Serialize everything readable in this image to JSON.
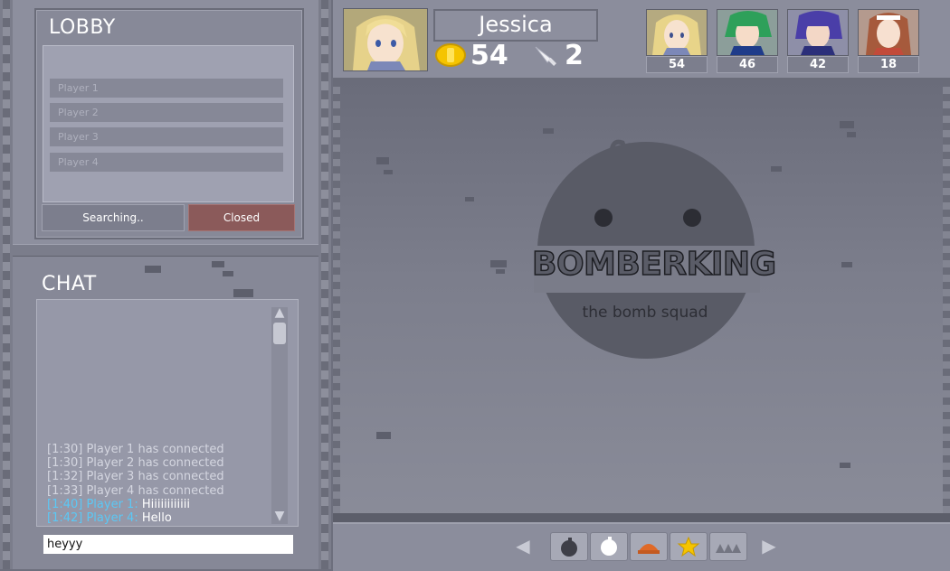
{
  "lobby": {
    "title": "LOBBY",
    "players": [
      "Player 1",
      "Player 2",
      "Player 3",
      "Player 4"
    ],
    "search_label": "Searching..",
    "closed_label": "Closed"
  },
  "chat": {
    "title": "CHAT",
    "messages": [
      {
        "text": "[1:30] Player 1 has connected"
      },
      {
        "text": "[1:30] Player 2 has connected"
      },
      {
        "text": "[1:32] Player 3 has connected"
      },
      {
        "text": "[1:33] Player 4 has connected"
      },
      {
        "who": "[1:40] Player 1:",
        "text": " Hiiiiiiiiiiii"
      },
      {
        "who": "[1:42] Player 4:",
        "text": " Hello"
      }
    ],
    "input_value": "heyyy"
  },
  "player": {
    "name": "Jessica",
    "coins": "54",
    "swords": "2"
  },
  "scoreboard": [
    {
      "score": "54",
      "hair": "#e8d489",
      "accent": "#3d4f8f"
    },
    {
      "score": "46",
      "hair": "#2ea05a",
      "accent": "#1f3c8a"
    },
    {
      "score": "42",
      "hair": "#4a3ea8",
      "accent": "#2b2f7a"
    },
    {
      "score": "18",
      "hair": "#a65a3c",
      "accent": "#c24a3a"
    }
  ],
  "logo": {
    "title": "BOMBERKING",
    "subtitle": "the bomb squad"
  },
  "colors": {
    "chat_name": "#5bc8f5",
    "closed_button": "#8b5a5a",
    "coin": "#f5c400"
  },
  "toolbar_icons": [
    "bomb-icon",
    "egg-icon",
    "mine-icon",
    "star-icon",
    "spikes-icon"
  ]
}
